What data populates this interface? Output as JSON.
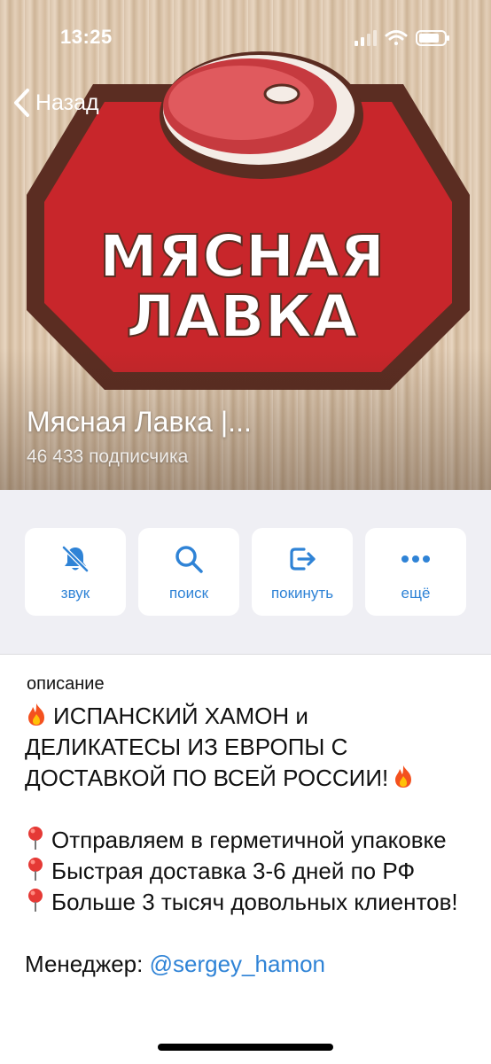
{
  "status_bar": {
    "time": "13:25"
  },
  "nav": {
    "back_label": "Назад"
  },
  "channel": {
    "title": "Мясная Лавка |...",
    "subscribers": "46 433 подписчика",
    "logo_text_line1": "МЯСНАЯ",
    "logo_text_line2": "ЛАВКА"
  },
  "actions": [
    {
      "label": "звук",
      "icon": "bell-muted-icon"
    },
    {
      "label": "поиск",
      "icon": "search-icon"
    },
    {
      "label": "покинуть",
      "icon": "leave-icon"
    },
    {
      "label": "ещё",
      "icon": "more-icon"
    }
  ],
  "description": {
    "label": "описание",
    "headline": "ИСПАНСКИЙ ХАМОН и ДЕЛИКАТЕСЫ ИЗ ЕВРОПЫ С ДОСТАВКОЙ ПО ВСЕЙ РОССИИ!",
    "bullets": [
      "Отправляем в герметичной упаковке",
      "Быстрая доставка 3-6 дней по РФ",
      "Больше 3 тысяч довольных клиентов!"
    ],
    "manager_label": "Менеджер:",
    "manager_link": "@sergey_hamon"
  },
  "colors": {
    "accent": "#2f83d6",
    "logo_red": "#c8262b",
    "logo_dark": "#5b2d22"
  }
}
